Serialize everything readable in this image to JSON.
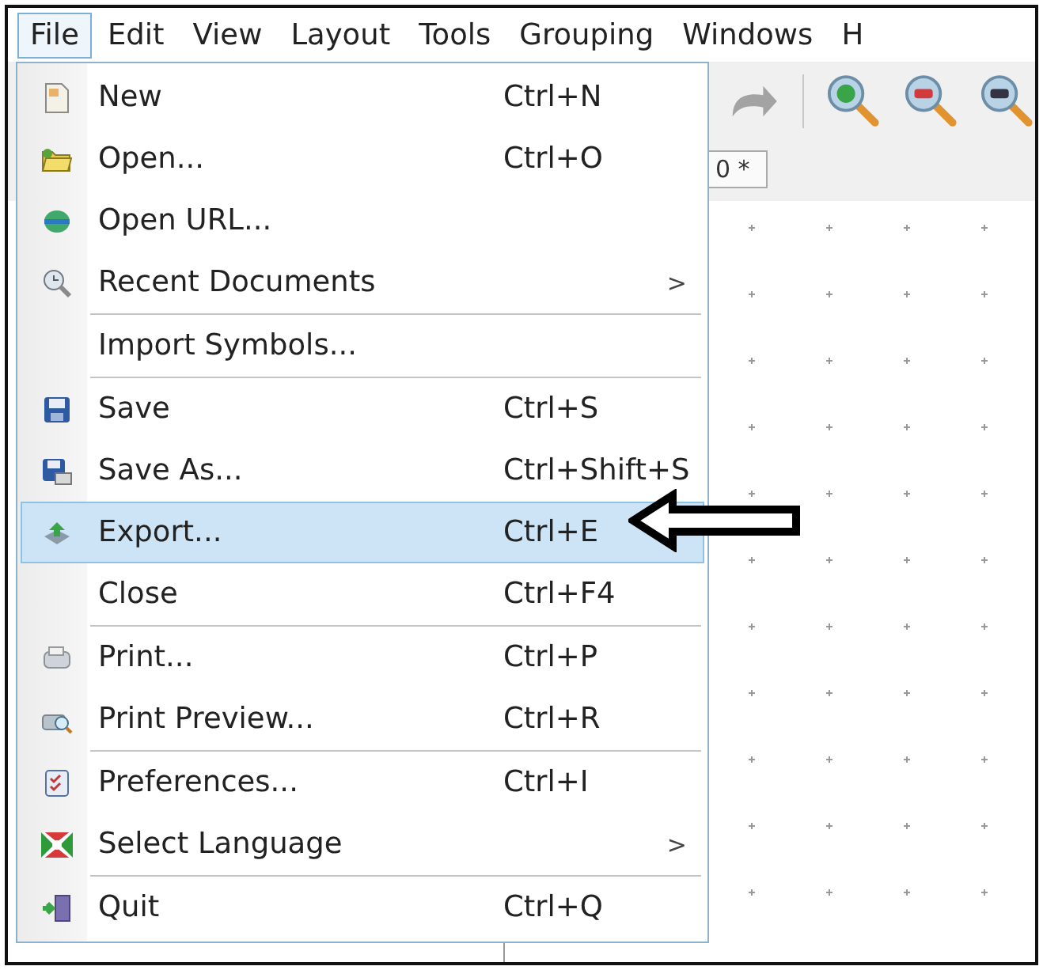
{
  "menu_bar": [
    {
      "label": "File",
      "selected": true
    },
    {
      "label": "Edit",
      "selected": false
    },
    {
      "label": "View",
      "selected": false
    },
    {
      "label": "Layout",
      "selected": false
    },
    {
      "label": "Tools",
      "selected": false
    },
    {
      "label": "Grouping",
      "selected": false
    },
    {
      "label": "Windows",
      "selected": false
    },
    {
      "label": "H",
      "selected": false
    }
  ],
  "document_tab": {
    "label": "0 *"
  },
  "file_menu": {
    "groups": [
      [
        {
          "label": "New",
          "shortcut": "Ctrl+N",
          "selected": false
        },
        {
          "label": "Open...",
          "shortcut": "Ctrl+O",
          "selected": false
        },
        {
          "label": "Open URL...",
          "selected": false
        },
        {
          "label": "Recent Documents",
          "submenu": ">",
          "selected": false
        }
      ],
      [
        {
          "label": "Import Symbols...",
          "selected": false
        }
      ],
      [
        {
          "label": "Save",
          "shortcut": "Ctrl+S",
          "selected": false
        },
        {
          "label": "Save As...",
          "shortcut": "Ctrl+Shift+S",
          "selected": false
        },
        {
          "label": "Export...",
          "shortcut": "Ctrl+E",
          "selected": true
        },
        {
          "label": "Close",
          "shortcut": "Ctrl+F4",
          "selected": false
        }
      ],
      [
        {
          "label": "Print...",
          "shortcut": "Ctrl+P",
          "selected": false
        },
        {
          "label": "Print Preview...",
          "shortcut": "Ctrl+R",
          "selected": false
        }
      ],
      [
        {
          "label": "Preferences...",
          "shortcut": "Ctrl+I",
          "selected": false
        },
        {
          "label": "Select Language",
          "submenu": ">",
          "selected": false
        }
      ],
      [
        {
          "label": "Quit",
          "shortcut": "Ctrl+Q",
          "selected": false
        }
      ]
    ]
  }
}
